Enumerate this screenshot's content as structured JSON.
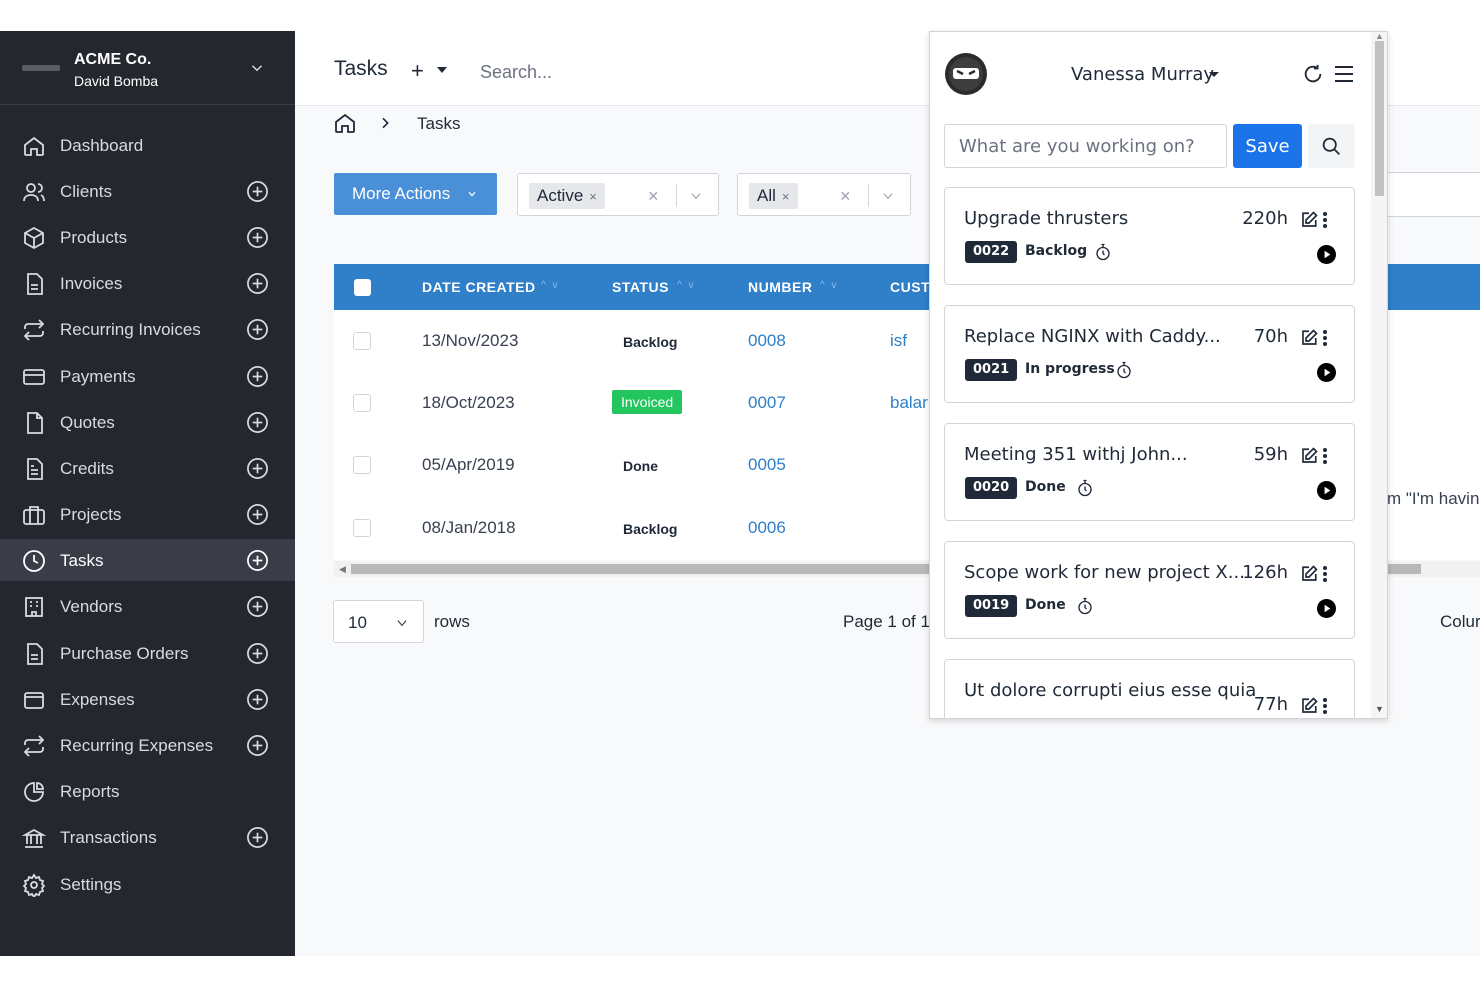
{
  "company": {
    "name": "ACME Co.",
    "user": "David Bomba"
  },
  "sidebar": {
    "items": [
      {
        "label": "Dashboard",
        "icon": "home-icon"
      },
      {
        "label": "Clients",
        "icon": "users-icon"
      },
      {
        "label": "Products",
        "icon": "box-icon"
      },
      {
        "label": "Invoices",
        "icon": "file-icon"
      },
      {
        "label": "Recurring Invoices",
        "icon": "repeat-icon"
      },
      {
        "label": "Payments",
        "icon": "credit-card-icon"
      },
      {
        "label": "Quotes",
        "icon": "document-icon"
      },
      {
        "label": "Credits",
        "icon": "file-text-icon"
      },
      {
        "label": "Projects",
        "icon": "briefcase-icon"
      },
      {
        "label": "Tasks",
        "icon": "clock-icon"
      },
      {
        "label": "Vendors",
        "icon": "building-icon"
      },
      {
        "label": "Purchase Orders",
        "icon": "file-icon"
      },
      {
        "label": "Expenses",
        "icon": "wallet-icon"
      },
      {
        "label": "Recurring Expenses",
        "icon": "repeat-icon"
      },
      {
        "label": "Reports",
        "icon": "pie-chart-icon"
      },
      {
        "label": "Transactions",
        "icon": "bank-icon"
      },
      {
        "label": "Settings",
        "icon": "gear-icon"
      }
    ]
  },
  "header": {
    "title": "Tasks",
    "add": "+",
    "search_placeholder": "Search..."
  },
  "breadcrumb": {
    "current": "Tasks"
  },
  "toolbar": {
    "more_actions": "More Actions",
    "status_filter": "Active",
    "client_filter": "All",
    "chip_x": "×",
    "clear_x": "×"
  },
  "table": {
    "headers": {
      "date": "DATE CREATED",
      "status": "STATUS",
      "number": "NUMBER",
      "customer": "CUST"
    },
    "sort_arrows": "^ v",
    "rows": [
      {
        "date": "13/Nov/2023",
        "status": "Backlog",
        "number": "0008",
        "customer": "isf"
      },
      {
        "date": "18/Oct/2023",
        "status": "Invoiced",
        "number": "0007",
        "customer": "balar"
      },
      {
        "date": "05/Apr/2019",
        "status": "Done",
        "number": "0005",
        "customer": ""
      },
      {
        "date": "08/Jan/2018",
        "status": "Backlog",
        "number": "0006",
        "customer": ""
      }
    ],
    "overflow_text": "m \"I'm havin"
  },
  "pagination": {
    "per_page": "10",
    "rows_label": "rows",
    "page_info": "Page 1 of 1.",
    "columns_partial": "Colur"
  },
  "popup": {
    "user": "Vanessa Murray",
    "work_placeholder": "What are you working on?",
    "save_label": "Save",
    "tasks": [
      {
        "title": "Upgrade thrusters",
        "hours": "220h",
        "code": "0022",
        "status": "Backlog"
      },
      {
        "title": "Replace NGINX with Caddy...",
        "hours": "70h",
        "code": "0021",
        "status": "In progress"
      },
      {
        "title": "Meeting 351 withj John...",
        "hours": "59h",
        "code": "0020",
        "status": "Done"
      },
      {
        "title": "Scope work for new project X...",
        "hours": "126h",
        "code": "0019",
        "status": "Done"
      },
      {
        "title": "Ut dolore corrupti eius esse quia",
        "hours": "77h",
        "code": "",
        "status": ""
      }
    ]
  },
  "colors": {
    "sidebar_bg": "#25272f",
    "accent": "#2f7fc9",
    "save": "#1a73e8",
    "invoiced": "#22c55e"
  }
}
